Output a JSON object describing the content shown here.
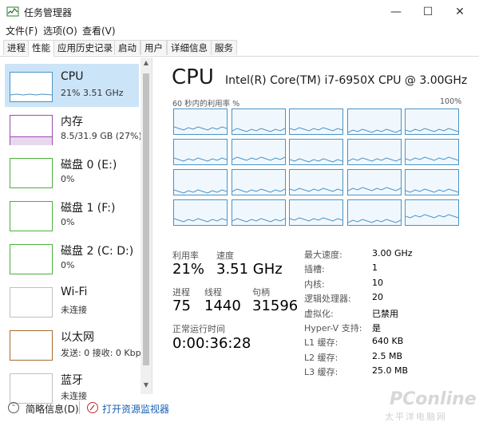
{
  "window": {
    "title": "任务管理器",
    "minimize": "—",
    "maximize": "☐",
    "close": "✕"
  },
  "menu": [
    "文件(F)",
    "选项(O)",
    "查看(V)"
  ],
  "tabs": [
    "进程",
    "性能",
    "应用历史记录",
    "启动",
    "用户",
    "详细信息",
    "服务"
  ],
  "active_tab": "性能",
  "sidebar": {
    "items": [
      {
        "name": "CPU",
        "sub": "21% 3.51 GHz",
        "color": "#4a93c5"
      },
      {
        "name": "内存",
        "sub": "8.5/31.9 GB (27%)",
        "color": "#9b4cad"
      },
      {
        "name": "磁盘 0 (E:)",
        "sub": "0%",
        "color": "#4caf3d"
      },
      {
        "name": "磁盘 1 (F:)",
        "sub": "0%",
        "color": "#4caf3d"
      },
      {
        "name": "磁盘 2 (C: D:)",
        "sub": "0%",
        "color": "#4caf3d"
      },
      {
        "name": "Wi-Fi",
        "sub": "未连接",
        "color": "#bfbfbf"
      },
      {
        "name": "以太网",
        "sub": "发送: 0 接收: 0 Kbps",
        "color": "#a66d2e"
      },
      {
        "name": "蓝牙",
        "sub": "未连接",
        "color": "#bfbfbf"
      }
    ]
  },
  "main": {
    "title": "CPU",
    "model": "Intel(R) Core(TM) i7-6950X CPU @ 3.00GHz",
    "graph_caption": "60 秒内的利用率 %",
    "graph_max": "100%",
    "core_count": 20,
    "graph_color": "#4a93c5",
    "stats": {
      "util_label": "利用率",
      "util_value": "21%",
      "speed_label": "速度",
      "speed_value": "3.51 GHz",
      "proc_label": "进程",
      "proc_value": "75",
      "thread_label": "线程",
      "thread_value": "1440",
      "handle_label": "句柄",
      "handle_value": "31596",
      "uptime_label": "正常运行时间",
      "uptime_value": "0:00:36:28"
    },
    "specs": [
      {
        "label": "最大速度:",
        "value": "3.00 GHz"
      },
      {
        "label": "插槽:",
        "value": "1"
      },
      {
        "label": "内核:",
        "value": "10"
      },
      {
        "label": "逻辑处理器:",
        "value": "20"
      },
      {
        "label": "虚拟化:",
        "value": "已禁用"
      },
      {
        "label": "Hyper-V 支持:",
        "value": "是"
      },
      {
        "label": "L1 缓存:",
        "value": "640 KB"
      },
      {
        "label": "L2 缓存:",
        "value": "2.5 MB"
      },
      {
        "label": "L3 缓存:",
        "value": "25.0 MB"
      }
    ]
  },
  "footer": {
    "brief": "简略信息(D)",
    "monitor": "打开资源监视器"
  },
  "watermark": {
    "brand": "PConline",
    "sub": "太平洋电脑网"
  }
}
